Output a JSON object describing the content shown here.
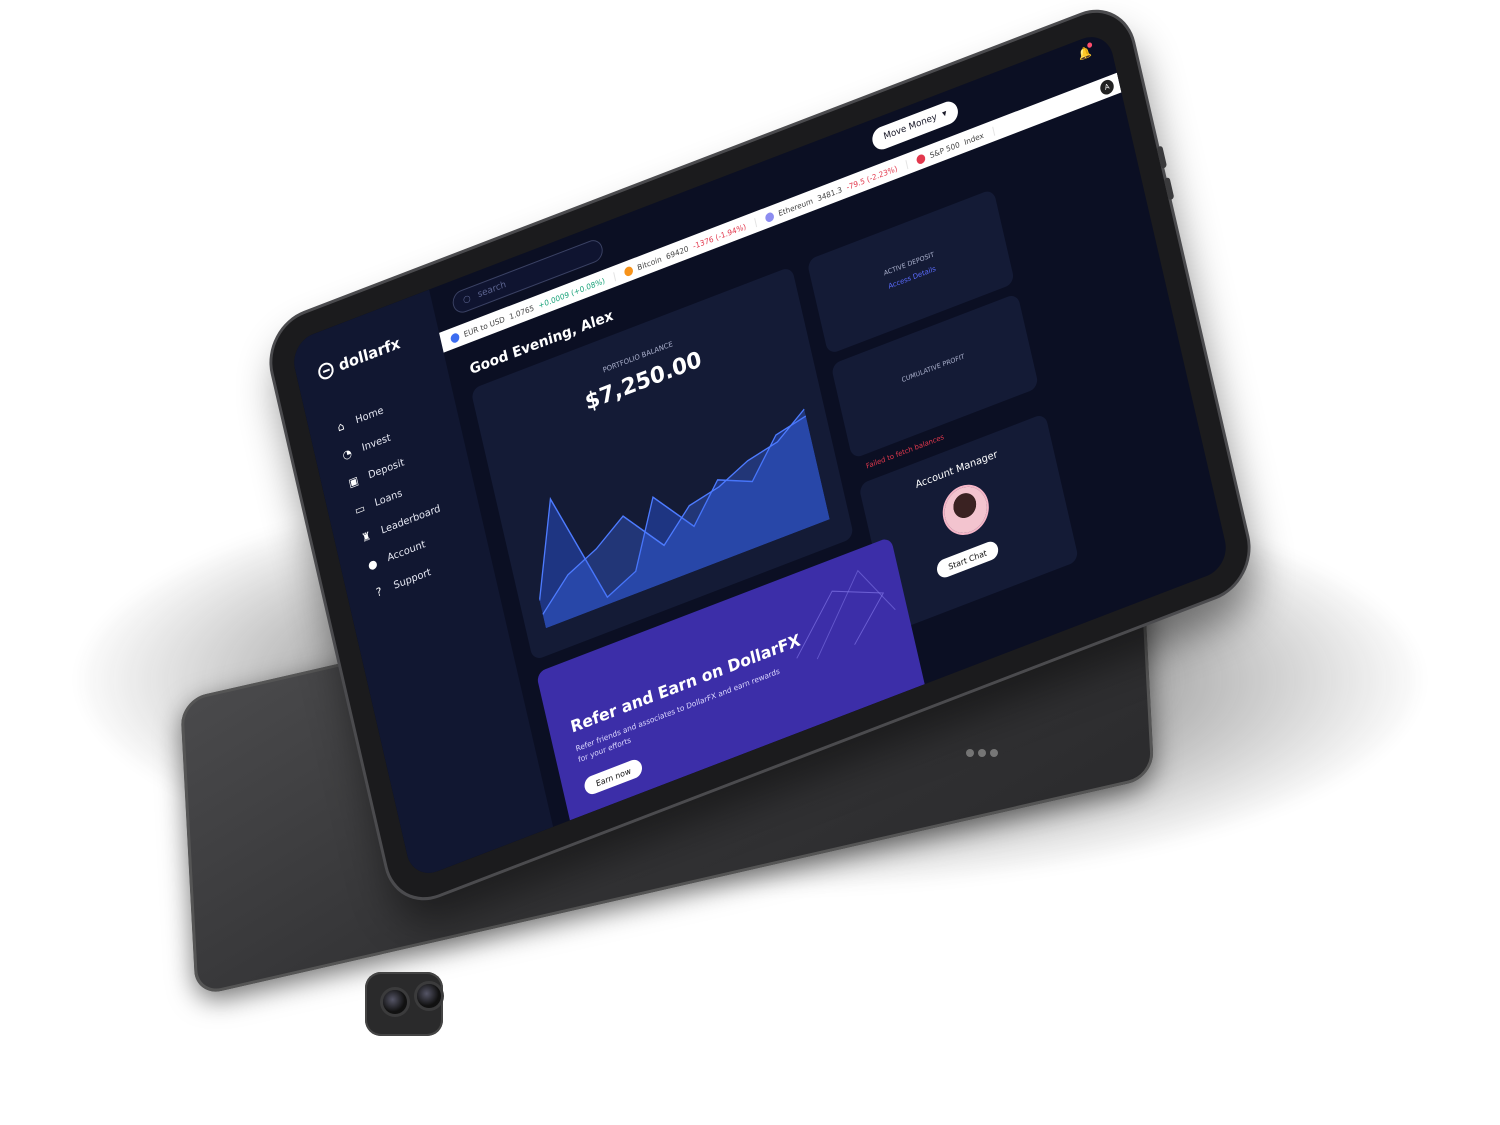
{
  "brand": {
    "name": "dollarfx"
  },
  "sidebar": {
    "items": [
      {
        "label": "Home",
        "icon": "home-icon"
      },
      {
        "label": "Invest",
        "icon": "pie-chart-icon"
      },
      {
        "label": "Deposit",
        "icon": "wallet-icon"
      },
      {
        "label": "Loans",
        "icon": "card-icon"
      },
      {
        "label": "Leaderboard",
        "icon": "trophy-icon"
      },
      {
        "label": "Account",
        "icon": "user-icon"
      },
      {
        "label": "Support",
        "icon": "help-icon"
      }
    ]
  },
  "topbar": {
    "search_placeholder": "search",
    "move_money_label": "Move Money"
  },
  "ticker": {
    "items": [
      {
        "name": "EUR to USD",
        "price": "1.0765",
        "change": "+0.0009 (+0.08%)",
        "direction": "up",
        "icon_color": "#3b6cf0"
      },
      {
        "name": "Bitcoin",
        "price": "69420",
        "change": "-1376 (-1.94%)",
        "direction": "down",
        "icon_color": "#f7931a"
      },
      {
        "name": "Ethereum",
        "price": "3481.3",
        "change": "-79.5 (-2.23%)",
        "direction": "down",
        "icon_color": "#8c8cf0"
      },
      {
        "name": "S&P 500",
        "price": "Index",
        "change": "",
        "direction": "flat",
        "icon_color": "#e2384d"
      }
    ]
  },
  "main": {
    "greeting": "Good Evening, Alex",
    "portfolio": {
      "label": "PORTFOLIO BALANCE",
      "amount": "$7,250.00"
    },
    "active_deposit": {
      "label": "ACTIVE DEPOSIT",
      "link": "Access Details"
    },
    "cumulative_profit": {
      "label": "CUMULATIVE PROFIT"
    },
    "error": "Failed to fetch balances",
    "account_manager": {
      "title": "Account Manager",
      "button": "Start Chat"
    },
    "refer": {
      "title": "Refer and Earn on DollarFX",
      "subtitle": "Refer friends and associates to DollarFX and earn rewards for your efforts",
      "button": "Earn now"
    }
  },
  "chart_data": {
    "type": "area",
    "series": [
      {
        "values": [
          0.2,
          0.85,
          0.05,
          0.15,
          0.6,
          0.3,
          0.55,
          0.45,
          0.7,
          0.75
        ]
      },
      {
        "values": [
          0.1,
          0.3,
          0.4,
          0.55,
          0.25,
          0.45,
          0.5,
          0.6,
          0.65,
          0.8
        ]
      }
    ],
    "colors": [
      "#2b57e0",
      "#3d6bf0"
    ]
  },
  "colors": {
    "background": "#0b0f23",
    "sidebar": "#111731",
    "card": "#141b36",
    "accent": "#5b6cff",
    "refer_banner": "#3c2ea8",
    "error": "#e2384d"
  }
}
